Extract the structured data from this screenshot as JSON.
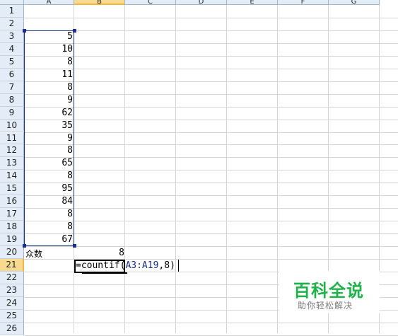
{
  "columns": [
    "A",
    "B",
    "C",
    "D",
    "E",
    "F",
    "G"
  ],
  "selected_column": "B",
  "rows": [
    "1",
    "2",
    "3",
    "4",
    "5",
    "6",
    "7",
    "8",
    "9",
    "10",
    "11",
    "12",
    "13",
    "14",
    "15",
    "16",
    "17",
    "18",
    "19",
    "20",
    "21",
    "22",
    "23",
    "24",
    "25",
    "26"
  ],
  "selected_row": "21",
  "data_values": [
    "5",
    "10",
    "8",
    "11",
    "8",
    "9",
    "62",
    "35",
    "9",
    "8",
    "65",
    "8",
    "95",
    "84",
    "8",
    "8",
    "67"
  ],
  "label_cell": "众数",
  "result_cell": "8",
  "formula": {
    "prefix": "=countif(",
    "range_ref": "A3:A19",
    "suffix": ",8)"
  },
  "watermark": {
    "title": "百科全说",
    "subtitle": "助你轻松解决",
    "title_color": "#1fb14a"
  },
  "colors": {
    "header_bg": "#e4ecf7",
    "selected_header_bg": "#f9d98f",
    "range_border": "#1a2f8c"
  }
}
